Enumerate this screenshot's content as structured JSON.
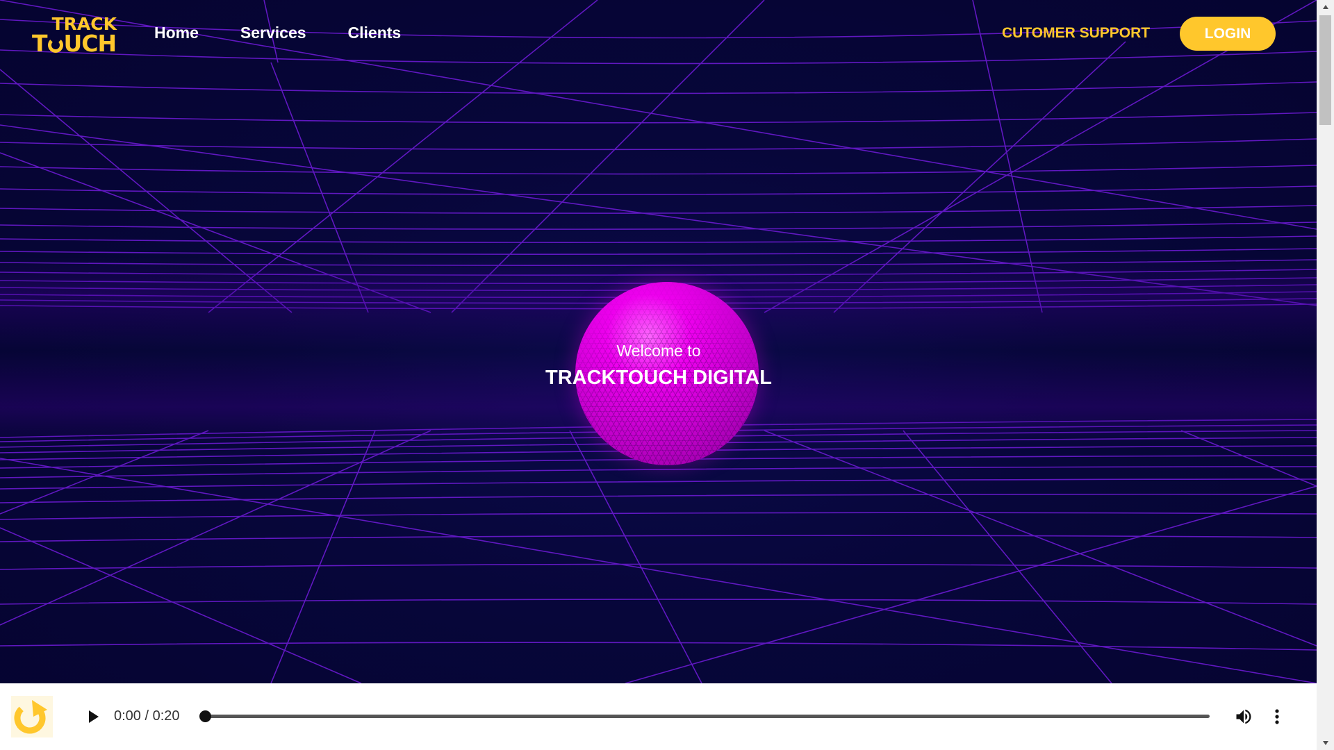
{
  "header": {
    "logo": {
      "line1": "TRACK",
      "line2_prefix": "T",
      "line2_suffix": "UCH"
    },
    "nav": [
      {
        "label": "Home"
      },
      {
        "label": "Services"
      },
      {
        "label": "Clients"
      }
    ],
    "support_label": "CUTOMER SUPPORT",
    "login_label": "LOGIN"
  },
  "hero": {
    "welcome": "Welcome to",
    "title": "TRACKTOUCH DIGITAL"
  },
  "audio_player": {
    "time_display": "0:00 / 0:20",
    "progress": 0,
    "icons": [
      "play-icon",
      "volume-icon",
      "more-vert-icon"
    ]
  },
  "colors": {
    "accent": "#ffc72c",
    "background": "#07063a",
    "grid": "#7a1fe0",
    "sphere": "#e600e6"
  }
}
